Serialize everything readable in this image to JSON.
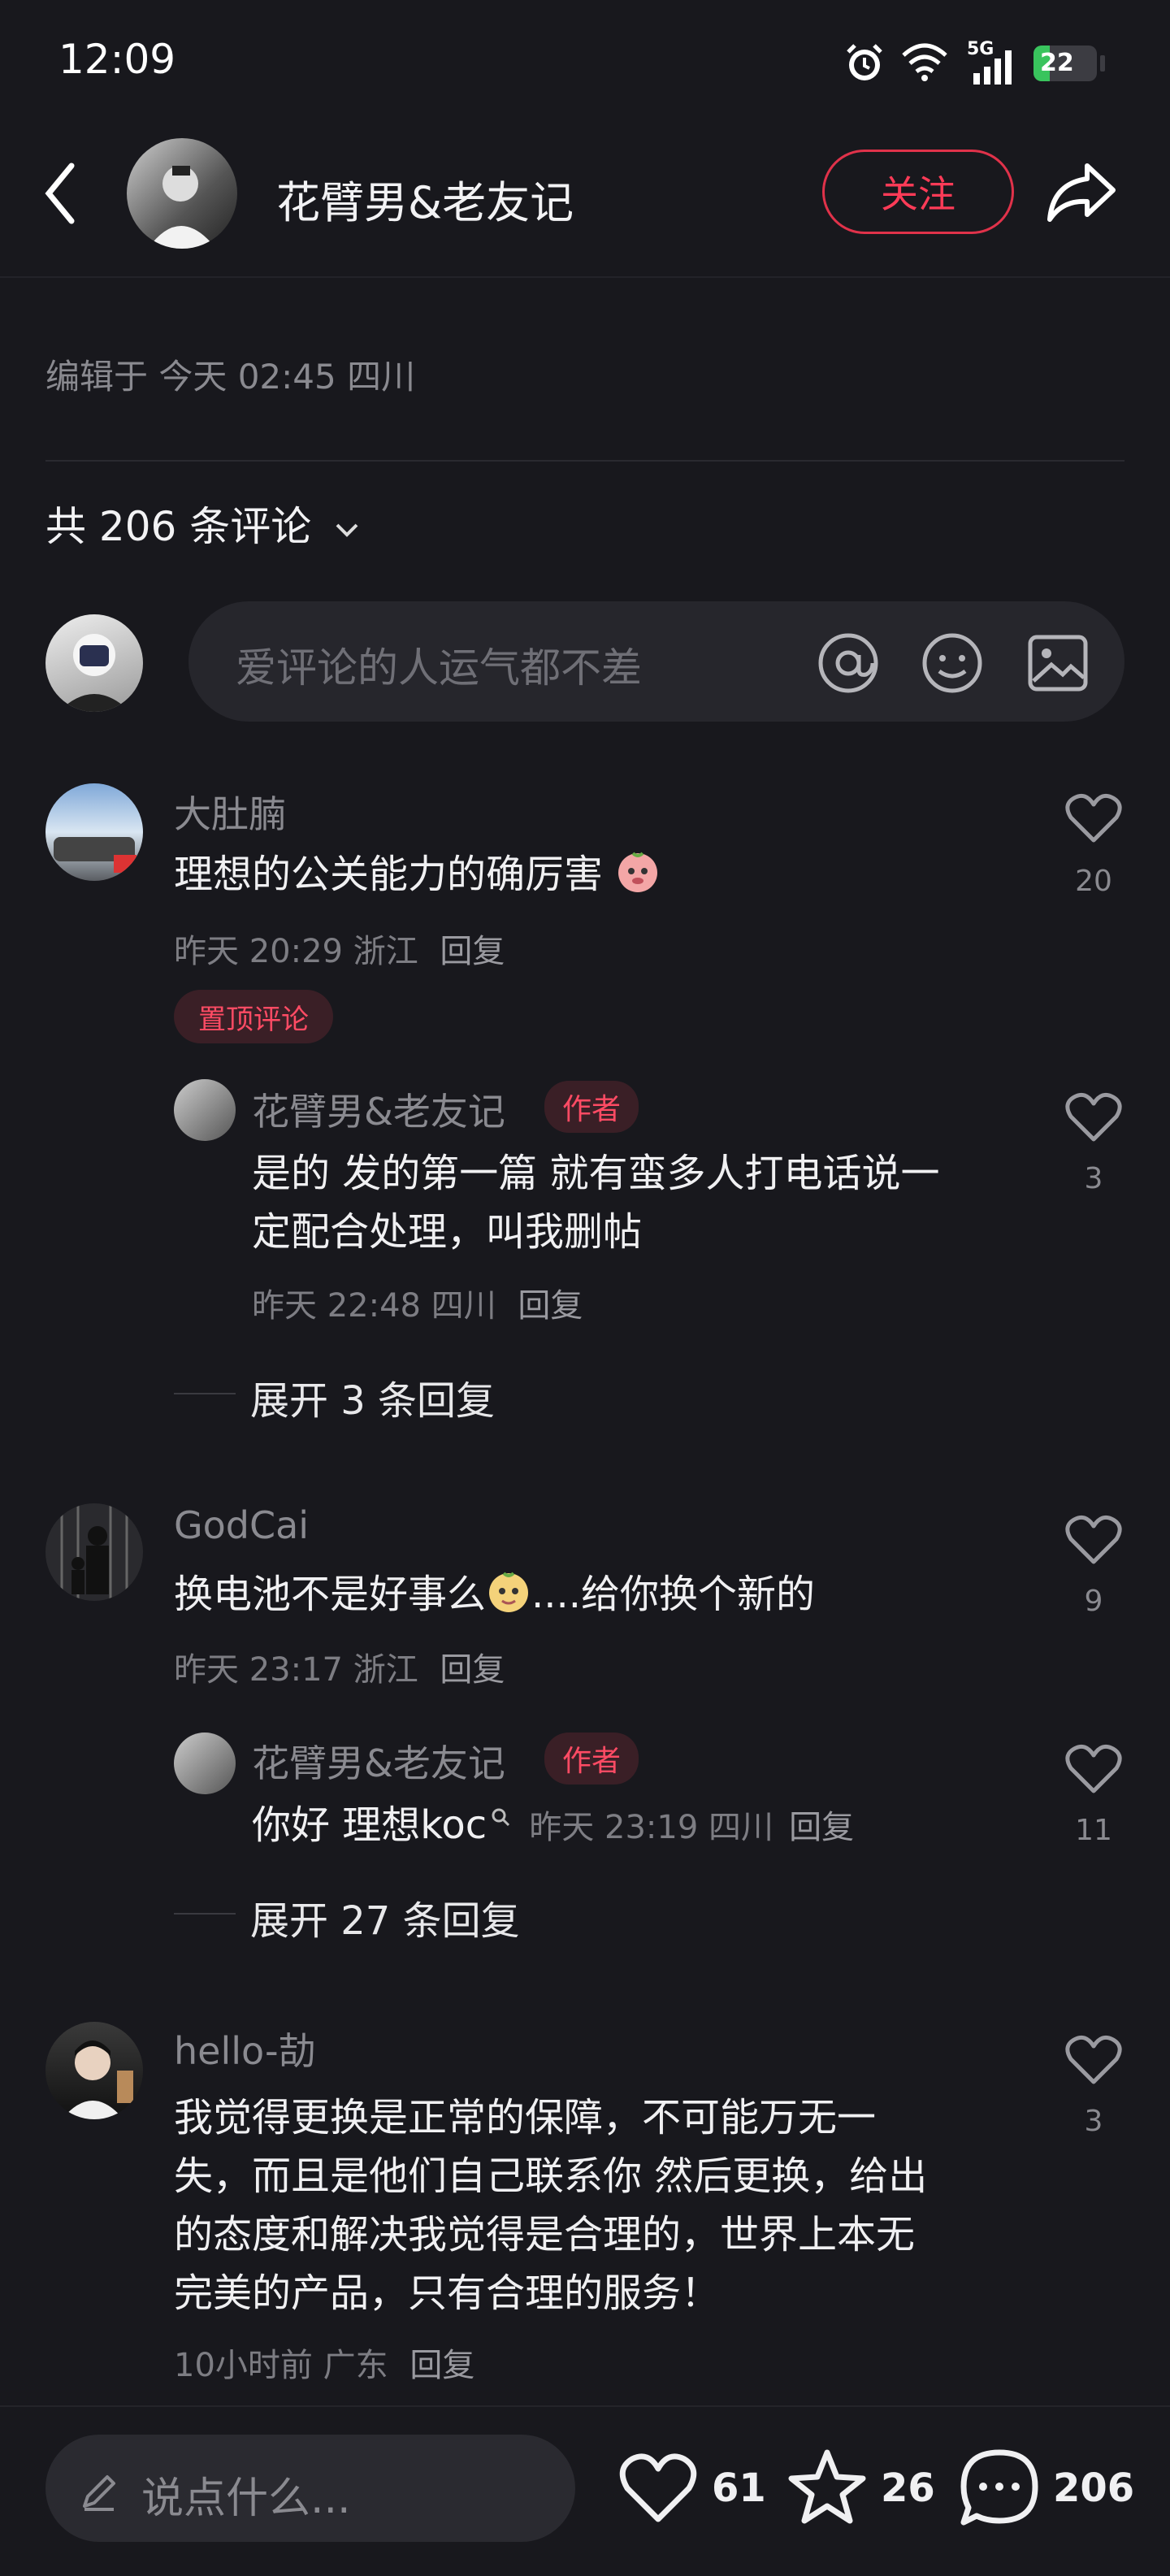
{
  "status_bar": {
    "time": "12:09",
    "network": "5G",
    "battery": "22"
  },
  "header": {
    "author_name": "花臂男&老友记",
    "follow_label": "关注"
  },
  "post": {
    "edit_info": "编辑于 今天 02:45 四川"
  },
  "comments_header": {
    "count_label": "共 206 条评论"
  },
  "comment_input": {
    "placeholder": "爱评论的人运气都不差"
  },
  "comments": [
    {
      "name": "大肚腩",
      "text": "理想的公关能力的确厉害",
      "meta": "昨天 20:29 浙江",
      "reply_label": "回复",
      "likes": "20",
      "pinned_label": "置顶评论",
      "reply": {
        "name": "花臂男&老友记",
        "tag": "作者",
        "text_line1": "是的 发的第一篇 就有蛮多人打电话说一",
        "text_line2": "定配合处理，叫我删帖",
        "meta": "昨天 22:48 四川",
        "reply_label": "回复",
        "likes": "3"
      },
      "expand_label": "展开 3 条回复"
    },
    {
      "name": "GodCai",
      "text_before": "换电池不是好事么",
      "text_after": "....给你换个新的",
      "meta": "昨天 23:17 浙江",
      "reply_label": "回复",
      "likes": "9",
      "reply": {
        "name": "花臂男&老友记",
        "tag": "作者",
        "text": "你好  理想koc",
        "meta": "昨天 23:19 四川",
        "reply_label": "回复",
        "likes": "11"
      },
      "expand_label": "展开 27 条回复"
    },
    {
      "name": "hello-劼",
      "lines": [
        "我觉得更换是正常的保障，不可能万无一",
        "失，而且是他们自己联系你 然后更换，给出",
        "的态度和解决我觉得是合理的，世界上本无",
        "完美的产品，只有合理的服务！"
      ],
      "meta": "10小时前 广东",
      "reply_label": "回复",
      "likes": "3"
    }
  ],
  "bottom_bar": {
    "input_placeholder": "说点什么...",
    "likes": "61",
    "favorites": "26",
    "comments": "206"
  }
}
